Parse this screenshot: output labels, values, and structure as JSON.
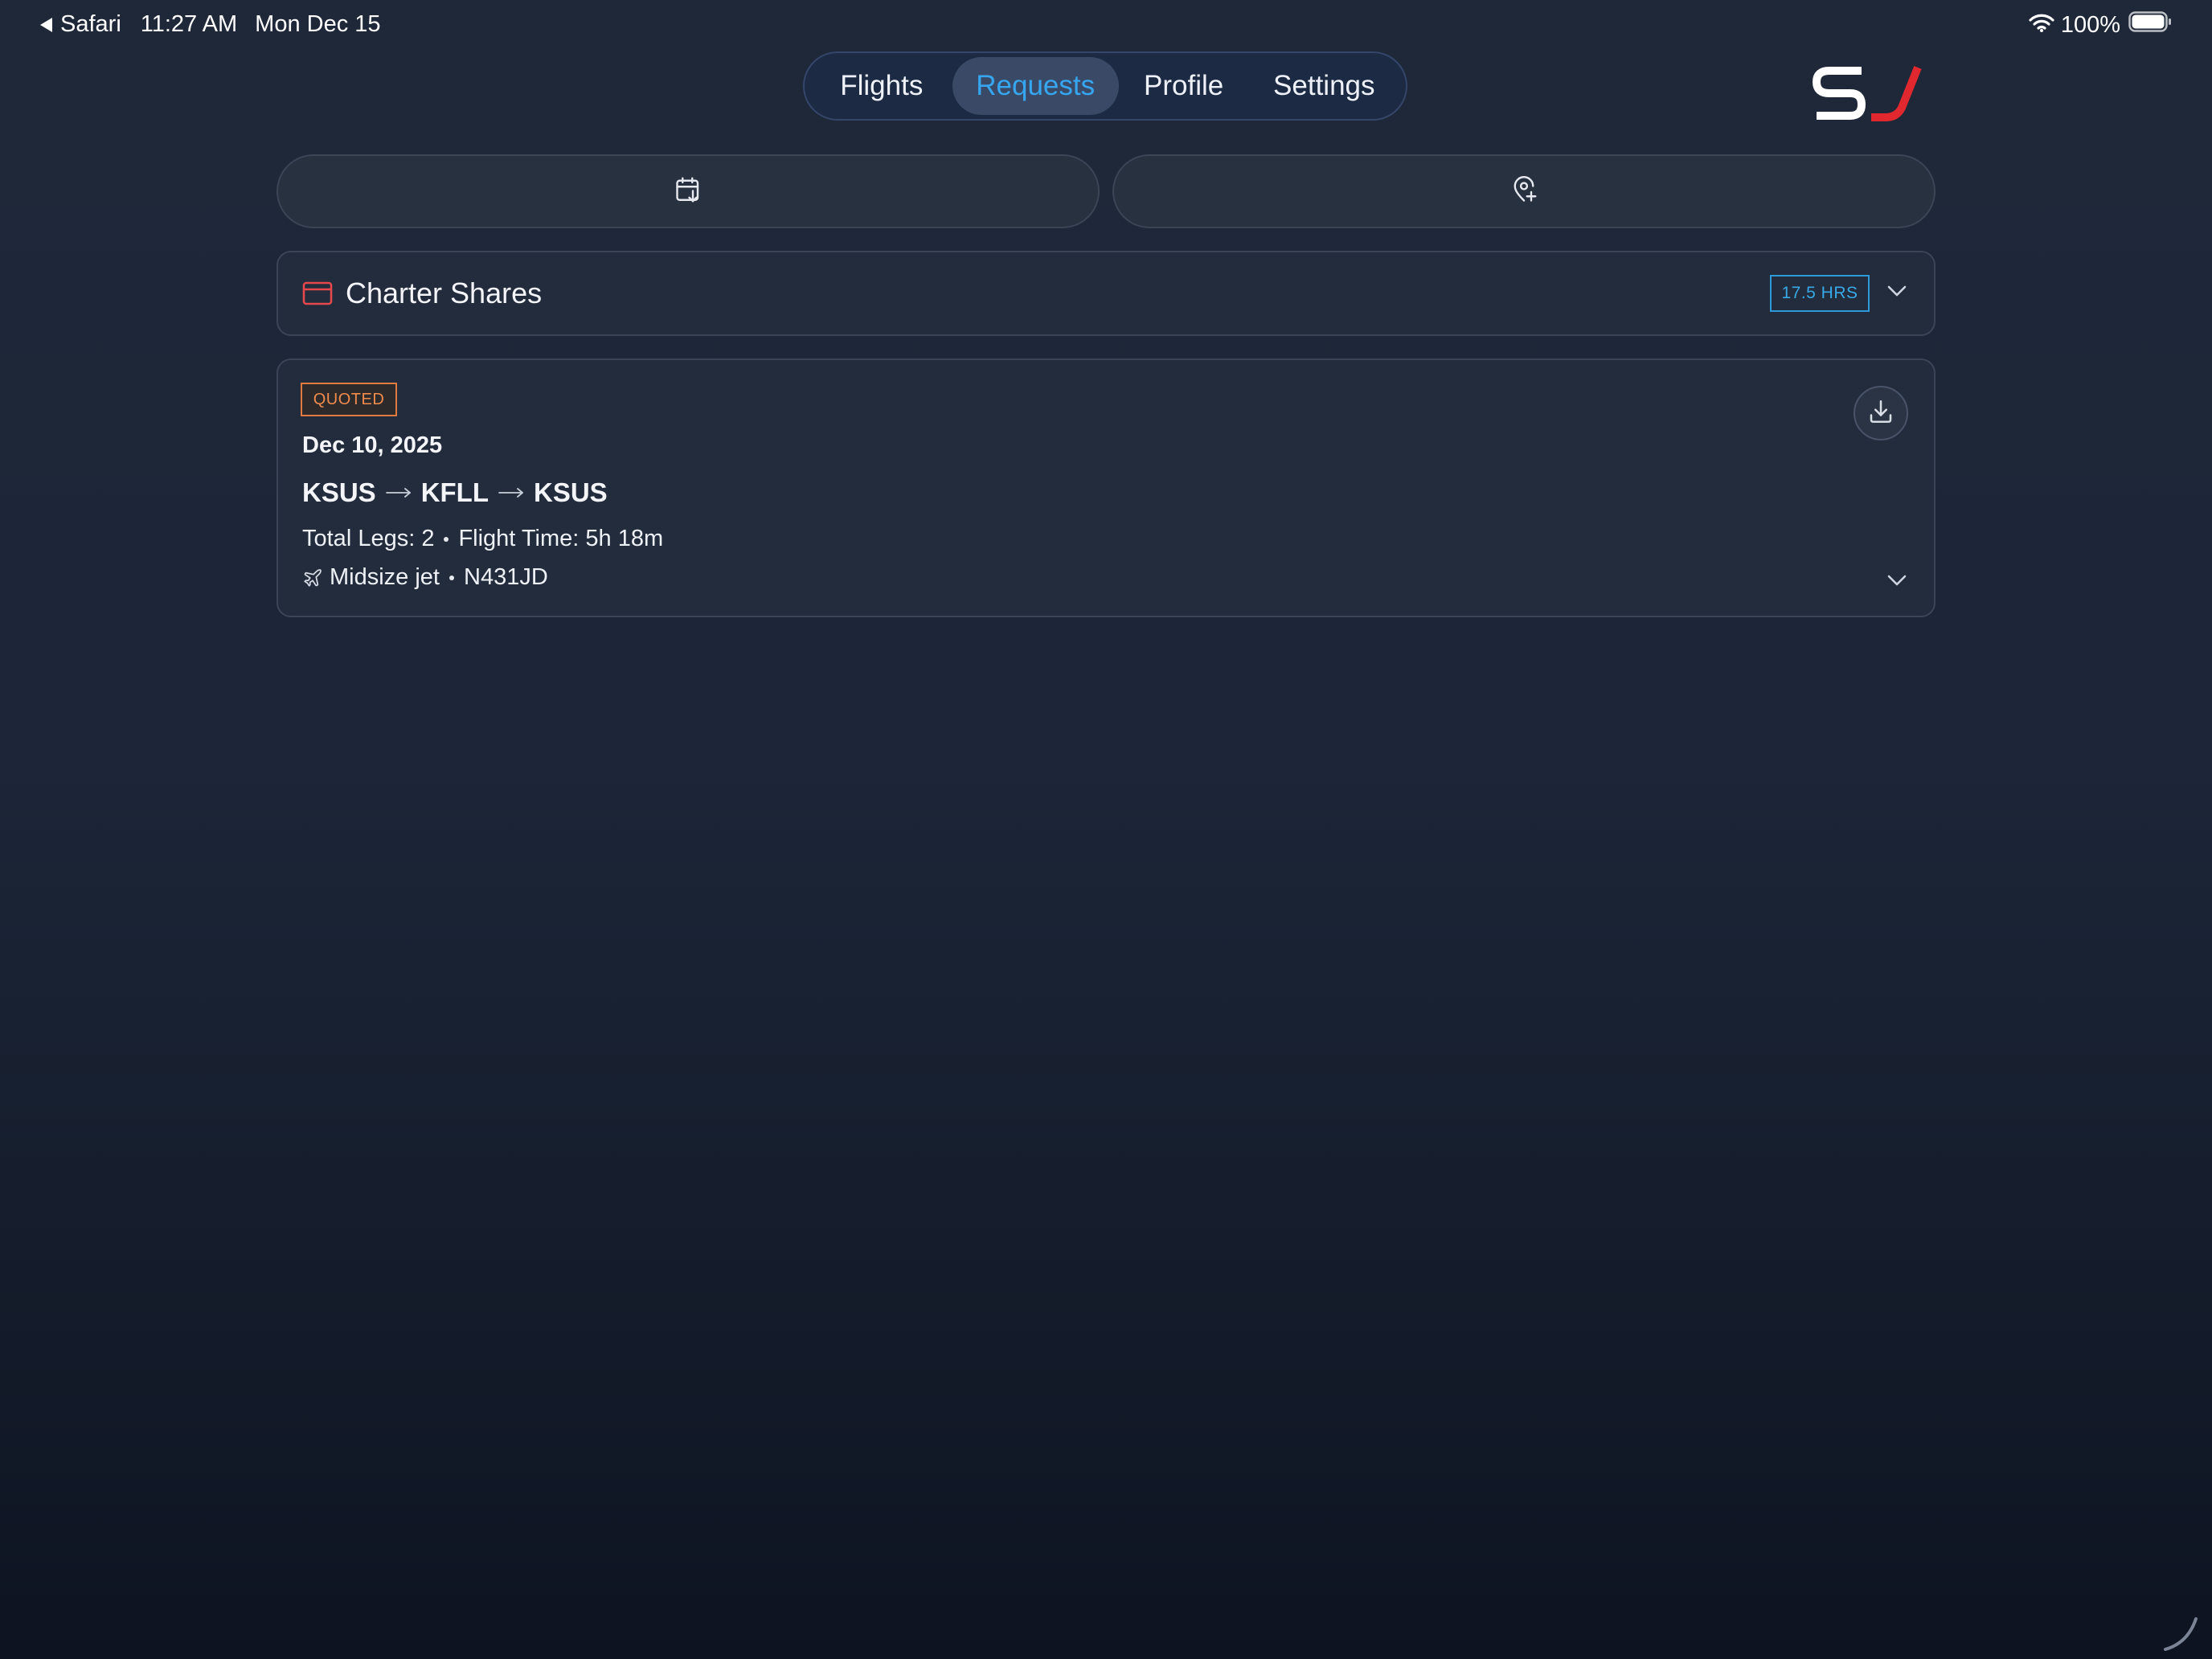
{
  "status_bar": {
    "back_app": "Safari",
    "time": "11:27 AM",
    "date": "Mon Dec 15",
    "battery": "100%"
  },
  "nav": {
    "tabs": [
      {
        "label": "Flights"
      },
      {
        "label": "Requests"
      },
      {
        "label": "Profile"
      },
      {
        "label": "Settings"
      }
    ],
    "active_tab": "Requests"
  },
  "actions": {
    "left_icon": "calendar-arrow-down-icon",
    "right_icon": "map-pin-plus-icon"
  },
  "shares": {
    "title": "Charter Shares",
    "hours_badge": "17.5 HRS"
  },
  "request": {
    "status": "QUOTED",
    "date": "Dec 10, 2025",
    "route": [
      "KSUS",
      "KFLL",
      "KSUS"
    ],
    "total_legs": "Total Legs: 2",
    "flight_time": "Flight Time: 5h 18m",
    "aircraft_type": "Midsize jet",
    "tail_number": "N431JD"
  },
  "colors": {
    "accent_blue": "#36a6f0",
    "brand_red": "#e0282e",
    "quoted_orange": "#f08b4e",
    "card_icon_red": "#e5484d"
  }
}
